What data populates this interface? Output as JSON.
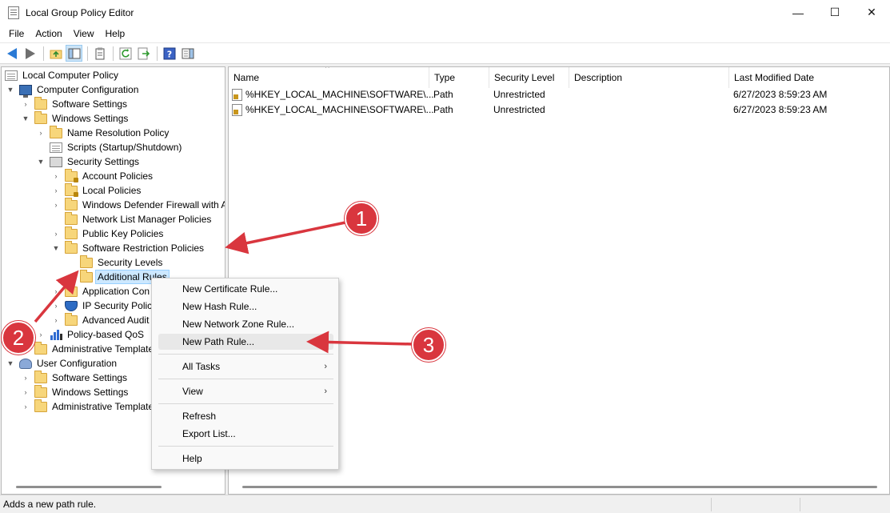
{
  "window": {
    "title": "Local Group Policy Editor",
    "minimize_icon": "—",
    "maximize_icon": "☐",
    "close_icon": "✕"
  },
  "menubar": {
    "items": [
      "File",
      "Action",
      "View",
      "Help"
    ]
  },
  "tree": {
    "items": [
      {
        "label": "Local Computer Policy"
      },
      {
        "label": "Computer Configuration"
      },
      {
        "label": "Software Settings"
      },
      {
        "label": "Windows Settings"
      },
      {
        "label": "Name Resolution Policy"
      },
      {
        "label": "Scripts (Startup/Shutdown)"
      },
      {
        "label": "Security Settings"
      },
      {
        "label": "Account Policies"
      },
      {
        "label": "Local Policies"
      },
      {
        "label": "Windows Defender Firewall with A"
      },
      {
        "label": "Network List Manager Policies"
      },
      {
        "label": "Public Key Policies"
      },
      {
        "label": "Software Restriction Policies"
      },
      {
        "label": "Security Levels"
      },
      {
        "label": "Additional Rules"
      },
      {
        "label": "Application Con"
      },
      {
        "label": "IP Security Polici"
      },
      {
        "label": "Advanced Audit"
      },
      {
        "label": "Policy-based QoS"
      },
      {
        "label": "Administrative Template"
      },
      {
        "label": "User Configuration"
      },
      {
        "label": "Software Settings"
      },
      {
        "label": "Windows Settings"
      },
      {
        "label": "Administrative Template"
      }
    ]
  },
  "list": {
    "columns": [
      "Name",
      "Type",
      "Security Level",
      "Description",
      "Last Modified Date"
    ],
    "rows": [
      {
        "name": "%HKEY_LOCAL_MACHINE\\SOFTWARE\\...",
        "type": "Path",
        "level": "Unrestricted",
        "description": "",
        "modified": "6/27/2023 8:59:23 AM"
      },
      {
        "name": "%HKEY_LOCAL_MACHINE\\SOFTWARE\\...",
        "type": "Path",
        "level": "Unrestricted",
        "description": "",
        "modified": "6/27/2023 8:59:23 AM"
      }
    ]
  },
  "context_menu": {
    "items": [
      "New Certificate Rule...",
      "New Hash Rule...",
      "New Network Zone Rule...",
      "New Path Rule...",
      "All Tasks",
      "View",
      "Refresh",
      "Export List...",
      "Help"
    ],
    "hovered": "New Path Rule..."
  },
  "status": {
    "text": "Adds a new path rule."
  },
  "callouts": {
    "labels": [
      "1",
      "2",
      "3"
    ],
    "color": "#d9363e"
  }
}
